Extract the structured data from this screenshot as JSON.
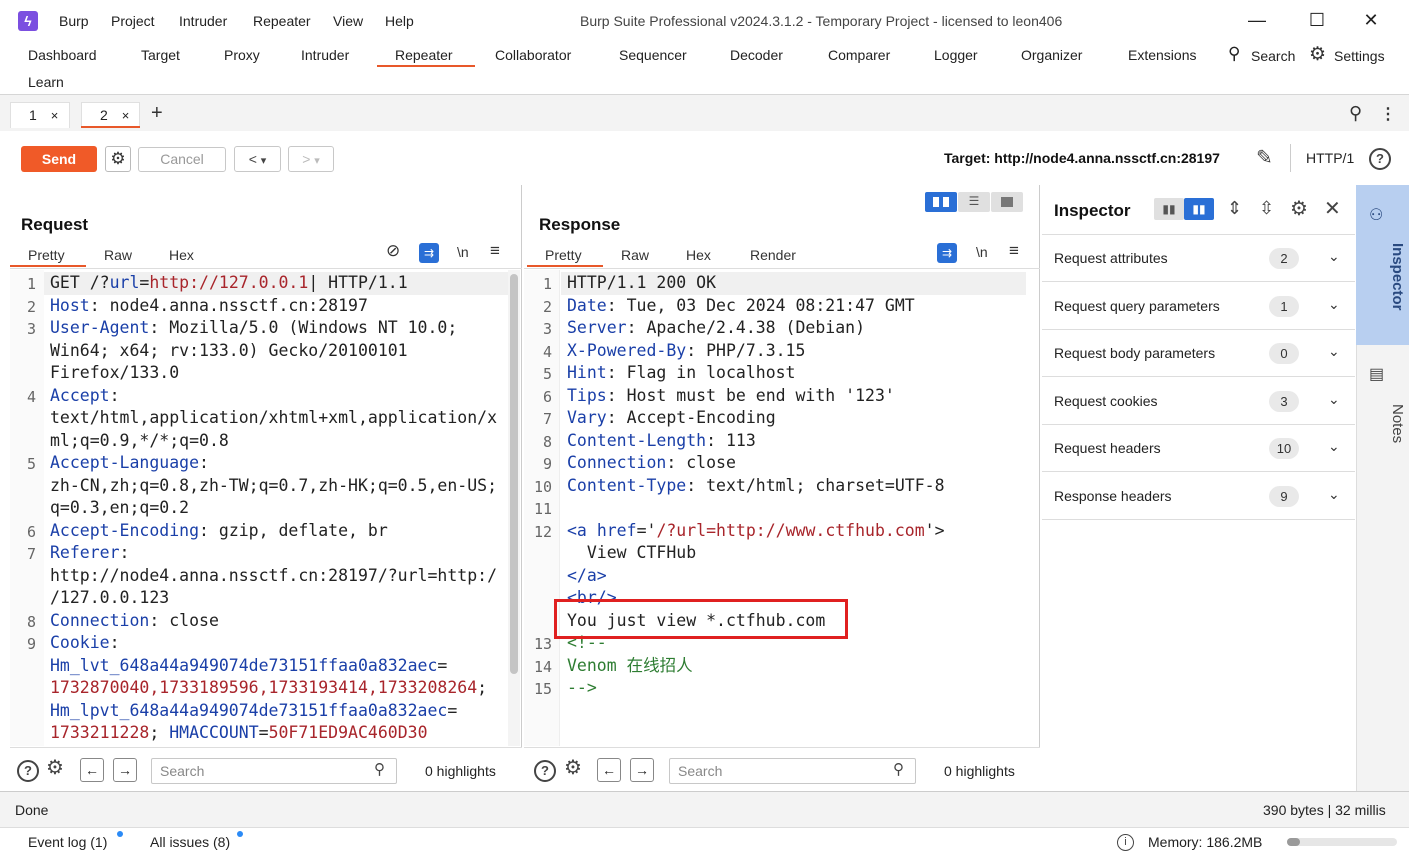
{
  "window": {
    "title": "Burp Suite Professional v2024.3.1.2 - Temporary Project - licensed to leon406",
    "menu": [
      "Burp",
      "Project",
      "Intruder",
      "Repeater",
      "View",
      "Help"
    ],
    "controls": {
      "minimize": "—",
      "maximize": "☐",
      "close": "✕"
    }
  },
  "main_tabs": {
    "items": [
      "Dashboard",
      "Target",
      "Proxy",
      "Intruder",
      "Repeater",
      "Collaborator",
      "Sequencer",
      "Decoder",
      "Comparer",
      "Logger",
      "Organizer",
      "Extensions"
    ],
    "learn": "Learn",
    "search": "Search",
    "settings": "Settings",
    "active": "Repeater"
  },
  "repeater_tabs": [
    {
      "label": "1",
      "close": "×"
    },
    {
      "label": "2",
      "close": "×"
    }
  ],
  "add_tab": "+",
  "toolbar": {
    "send": "Send",
    "cancel": "Cancel",
    "back": "<",
    "forward": ">",
    "dropdown": "▾",
    "target": "Target: http://node4.anna.nssctf.cn:28197",
    "protocol": "HTTP/1",
    "help": "?"
  },
  "request": {
    "title": "Request",
    "tabs": [
      "Pretty",
      "Raw",
      "Hex"
    ],
    "newline_toggle": "\\n",
    "line_numbers": [
      "1",
      "2",
      "3",
      "",
      "",
      "4",
      "",
      "",
      "5",
      "",
      "",
      "6",
      "7",
      "",
      "",
      "8",
      "9"
    ],
    "lines": [
      [
        {
          "t": "GET /?",
          "c": "hv"
        },
        {
          "t": "url",
          "c": "hk"
        },
        {
          "t": "=",
          "c": "hv"
        },
        {
          "t": "http://127.0.0.1",
          "c": "red"
        },
        {
          "t": "| HTTP/1.1",
          "c": "hv"
        }
      ],
      [
        {
          "t": "Host",
          "c": "hk"
        },
        {
          "t": ": node4.anna.nssctf.cn:28197",
          "c": "hv"
        }
      ],
      [
        {
          "t": "User-Agent",
          "c": "hk"
        },
        {
          "t": ": Mozilla/5.0 (Windows NT 10.0;",
          "c": "hv"
        }
      ],
      [
        {
          "t": "Win64; x64; rv:133.0) Gecko/20100101",
          "c": "hv"
        }
      ],
      [
        {
          "t": "Firefox/133.0",
          "c": "hv"
        }
      ],
      [
        {
          "t": "Accept",
          "c": "hk"
        },
        {
          "t": ":",
          "c": "hv"
        }
      ],
      [
        {
          "t": "text/html,application/xhtml+xml,application/x",
          "c": "hv"
        }
      ],
      [
        {
          "t": "ml;q=0.9,*/*;q=0.8",
          "c": "hv"
        }
      ],
      [
        {
          "t": "Accept-Language",
          "c": "hk"
        },
        {
          "t": ":",
          "c": "hv"
        }
      ],
      [
        {
          "t": "zh-CN,zh;q=0.8,zh-TW;q=0.7,zh-HK;q=0.5,en-US;",
          "c": "hv"
        }
      ],
      [
        {
          "t": "q=0.3,en;q=0.2",
          "c": "hv"
        }
      ],
      [
        {
          "t": "Accept-Encoding",
          "c": "hk"
        },
        {
          "t": ": gzip, deflate, br",
          "c": "hv"
        }
      ],
      [
        {
          "t": "Referer",
          "c": "hk"
        },
        {
          "t": ":",
          "c": "hv"
        }
      ],
      [
        {
          "t": "http://node4.anna.nssctf.cn:28197/?url=http:/",
          "c": "hv"
        }
      ],
      [
        {
          "t": "/127.0.0.123",
          "c": "hv"
        }
      ],
      [
        {
          "t": "Connection",
          "c": "hk"
        },
        {
          "t": ": close",
          "c": "hv"
        }
      ],
      [
        {
          "t": "Cookie",
          "c": "hk"
        },
        {
          "t": ":",
          "c": "hv"
        }
      ],
      [
        {
          "t": "Hm_lvt_648a44a949074de73151ffaa0a832aec",
          "c": "hk"
        },
        {
          "t": "=",
          "c": "hv"
        }
      ],
      [
        {
          "t": "1732870040,1733189596,1733193414,1733208264",
          "c": "red"
        },
        {
          "t": ";",
          "c": "hv"
        }
      ],
      [
        {
          "t": "Hm_lpvt_648a44a949074de73151ffaa0a832aec",
          "c": "hk"
        },
        {
          "t": "=",
          "c": "hv"
        }
      ],
      [
        {
          "t": "1733211228",
          "c": "red"
        },
        {
          "t": "; ",
          "c": "hv"
        },
        {
          "t": "HMACCOUNT",
          "c": "hk"
        },
        {
          "t": "=",
          "c": "hv"
        },
        {
          "t": "50F71ED9AC460D30",
          "c": "red"
        }
      ]
    ],
    "search_placeholder": "Search",
    "highlights": "0 highlights"
  },
  "response": {
    "title": "Response",
    "tabs": [
      "Pretty",
      "Raw",
      "Hex",
      "Render"
    ],
    "newline_toggle": "\\n",
    "line_numbers": [
      "1",
      "2",
      "3",
      "4",
      "5",
      "6",
      "7",
      "8",
      "9",
      "10",
      "11",
      "12",
      "",
      "",
      "",
      "",
      "13",
      "14",
      "15"
    ],
    "lines": [
      [
        {
          "t": "HTTP/1.1 200 OK",
          "c": "hv"
        }
      ],
      [
        {
          "t": "Date",
          "c": "hk"
        },
        {
          "t": ": Tue, 03 Dec 2024 08:21:47 GMT",
          "c": "hv"
        }
      ],
      [
        {
          "t": "Server",
          "c": "hk"
        },
        {
          "t": ": Apache/2.4.38 (Debian)",
          "c": "hv"
        }
      ],
      [
        {
          "t": "X-Powered-By",
          "c": "hk"
        },
        {
          "t": ": PHP/7.3.15",
          "c": "hv"
        }
      ],
      [
        {
          "t": "Hint",
          "c": "hk"
        },
        {
          "t": ": Flag in localhost",
          "c": "hv"
        }
      ],
      [
        {
          "t": "Tips",
          "c": "hk"
        },
        {
          "t": ": Host must be end with '123'",
          "c": "hv"
        }
      ],
      [
        {
          "t": "Vary",
          "c": "hk"
        },
        {
          "t": ": Accept-Encoding",
          "c": "hv"
        }
      ],
      [
        {
          "t": "Content-Length",
          "c": "hk"
        },
        {
          "t": ": 113",
          "c": "hv"
        }
      ],
      [
        {
          "t": "Connection",
          "c": "hk"
        },
        {
          "t": ": close",
          "c": "hv"
        }
      ],
      [
        {
          "t": "Content-Type",
          "c": "hk"
        },
        {
          "t": ": text/html; charset=UTF-8",
          "c": "hv"
        }
      ],
      [
        {
          "t": "",
          "c": "hv"
        }
      ],
      [
        {
          "t": "<a ",
          "c": "blue"
        },
        {
          "t": "href",
          "c": "blue"
        },
        {
          "t": "='",
          "c": "hv"
        },
        {
          "t": "/?url=http://www.ctfhub.com",
          "c": "red"
        },
        {
          "t": "'>",
          "c": "hv"
        }
      ],
      [
        {
          "t": "  View CTFHub",
          "c": "hv"
        }
      ],
      [
        {
          "t": "</a>",
          "c": "blue"
        }
      ],
      [
        {
          "t": "<br/>",
          "c": "blue"
        }
      ],
      [
        {
          "t": "You just view *.ctfhub.com",
          "c": "hv"
        }
      ],
      [
        {
          "t": "<!--",
          "c": "green"
        }
      ],
      [
        {
          "t": "Venom 在线招人",
          "c": "green"
        }
      ],
      [
        {
          "t": "-->",
          "c": "green"
        }
      ]
    ],
    "search_placeholder": "Search",
    "highlights": "0 highlights"
  },
  "inspector": {
    "title": "Inspector",
    "rows": [
      {
        "label": "Request attributes",
        "count": "2"
      },
      {
        "label": "Request query parameters",
        "count": "1"
      },
      {
        "label": "Request body parameters",
        "count": "0"
      },
      {
        "label": "Request cookies",
        "count": "3"
      },
      {
        "label": "Request headers",
        "count": "10"
      },
      {
        "label": "Response headers",
        "count": "9"
      }
    ],
    "side_tabs": [
      "Inspector",
      "Notes"
    ]
  },
  "status": {
    "left": "Done",
    "right": "390 bytes | 32 millis",
    "event_log": "Event log (1)",
    "all_issues": "All issues (8)",
    "memory": "Memory: 186.2MB"
  },
  "colors": {
    "accent": "#e8582a",
    "send_button": "#f05a28",
    "header_key": "#1a3fa8",
    "value_red": "#a8252b",
    "comment_green": "#2e7d32",
    "highlight_box": "#e02020",
    "inspector_tab": "#b8cff0"
  }
}
